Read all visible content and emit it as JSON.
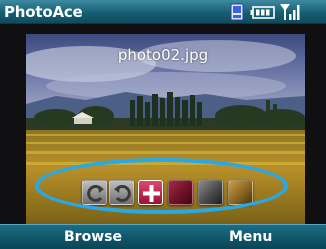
{
  "app": {
    "title": "PhotoAce"
  },
  "status": {
    "icons": [
      "phone-icon",
      "battery-icon",
      "signal-icon"
    ]
  },
  "viewer": {
    "filename": "photo02.jpg"
  },
  "toolbar": {
    "buttons": [
      {
        "name": "rotate-left-button",
        "icon": "rotate-left-icon"
      },
      {
        "name": "rotate-right-button",
        "icon": "rotate-right-icon"
      },
      {
        "name": "add-button",
        "icon": "plus-icon",
        "selected": true
      },
      {
        "name": "red-tint-button",
        "icon": "color-swatch-icon"
      },
      {
        "name": "gray-tint-button",
        "icon": "color-swatch-icon"
      },
      {
        "name": "sepia-tint-button",
        "icon": "color-swatch-icon"
      }
    ]
  },
  "softkeys": {
    "left": "Browse",
    "right": "Menu"
  },
  "colors": {
    "title_bar": "#175e73",
    "softkey_bar": "#0f5467",
    "highlight_ring": "#2aa8e4",
    "selected_button": "#c4204a"
  }
}
